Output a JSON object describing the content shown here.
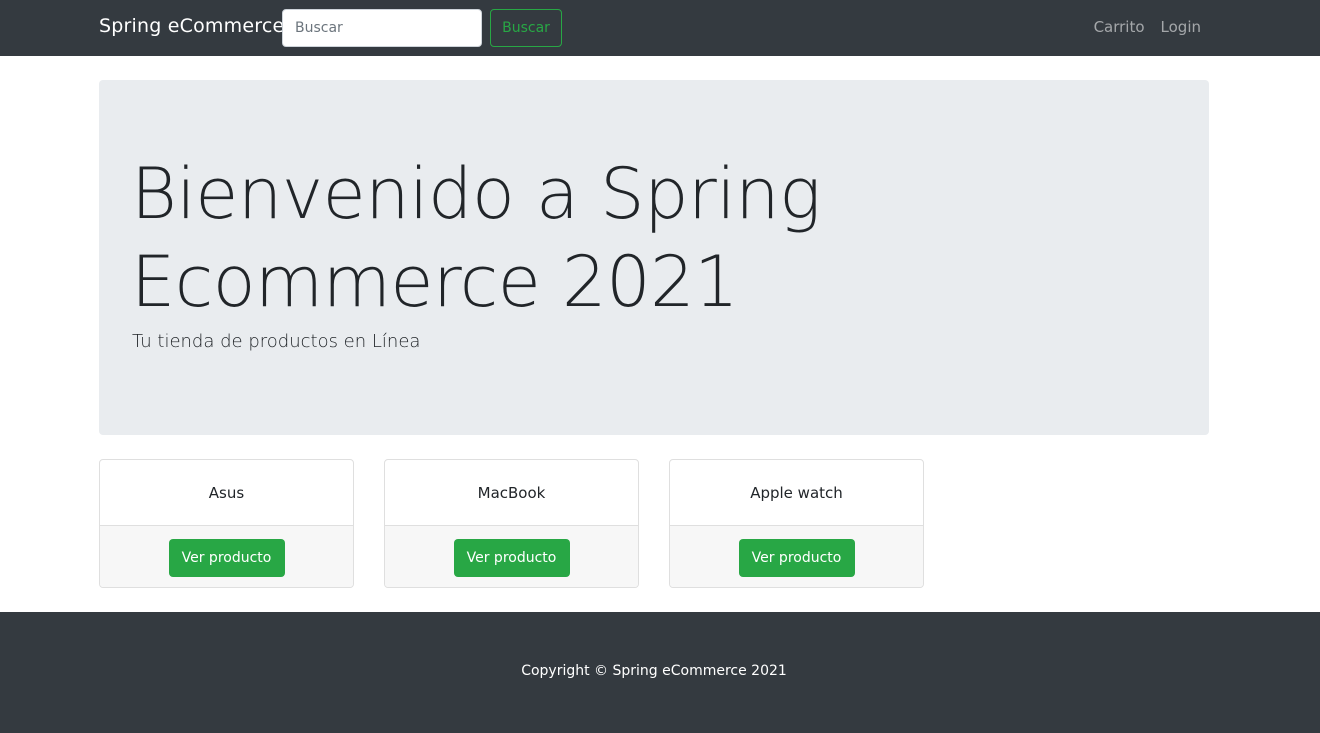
{
  "navbar": {
    "brand": "Spring eCommerce",
    "search": {
      "placeholder": "Buscar",
      "value": ""
    },
    "search_button": "Buscar",
    "links": [
      "Carrito",
      "Login"
    ]
  },
  "hero": {
    "title": "Bienvenido a Spring Ecommerce 2021",
    "subtitle": "Tu tienda de productos en Línea"
  },
  "products": [
    {
      "name": "Asus",
      "button": "Ver producto"
    },
    {
      "name": "MacBook",
      "button": "Ver producto"
    },
    {
      "name": "Apple watch",
      "button": "Ver producto"
    }
  ],
  "footer": {
    "copyright": "Copyright © Spring eCommerce 2021"
  },
  "colors": {
    "navbar_bg": "#343a40",
    "accent_green": "#28a745",
    "jumbotron_bg": "#e9ecef"
  }
}
